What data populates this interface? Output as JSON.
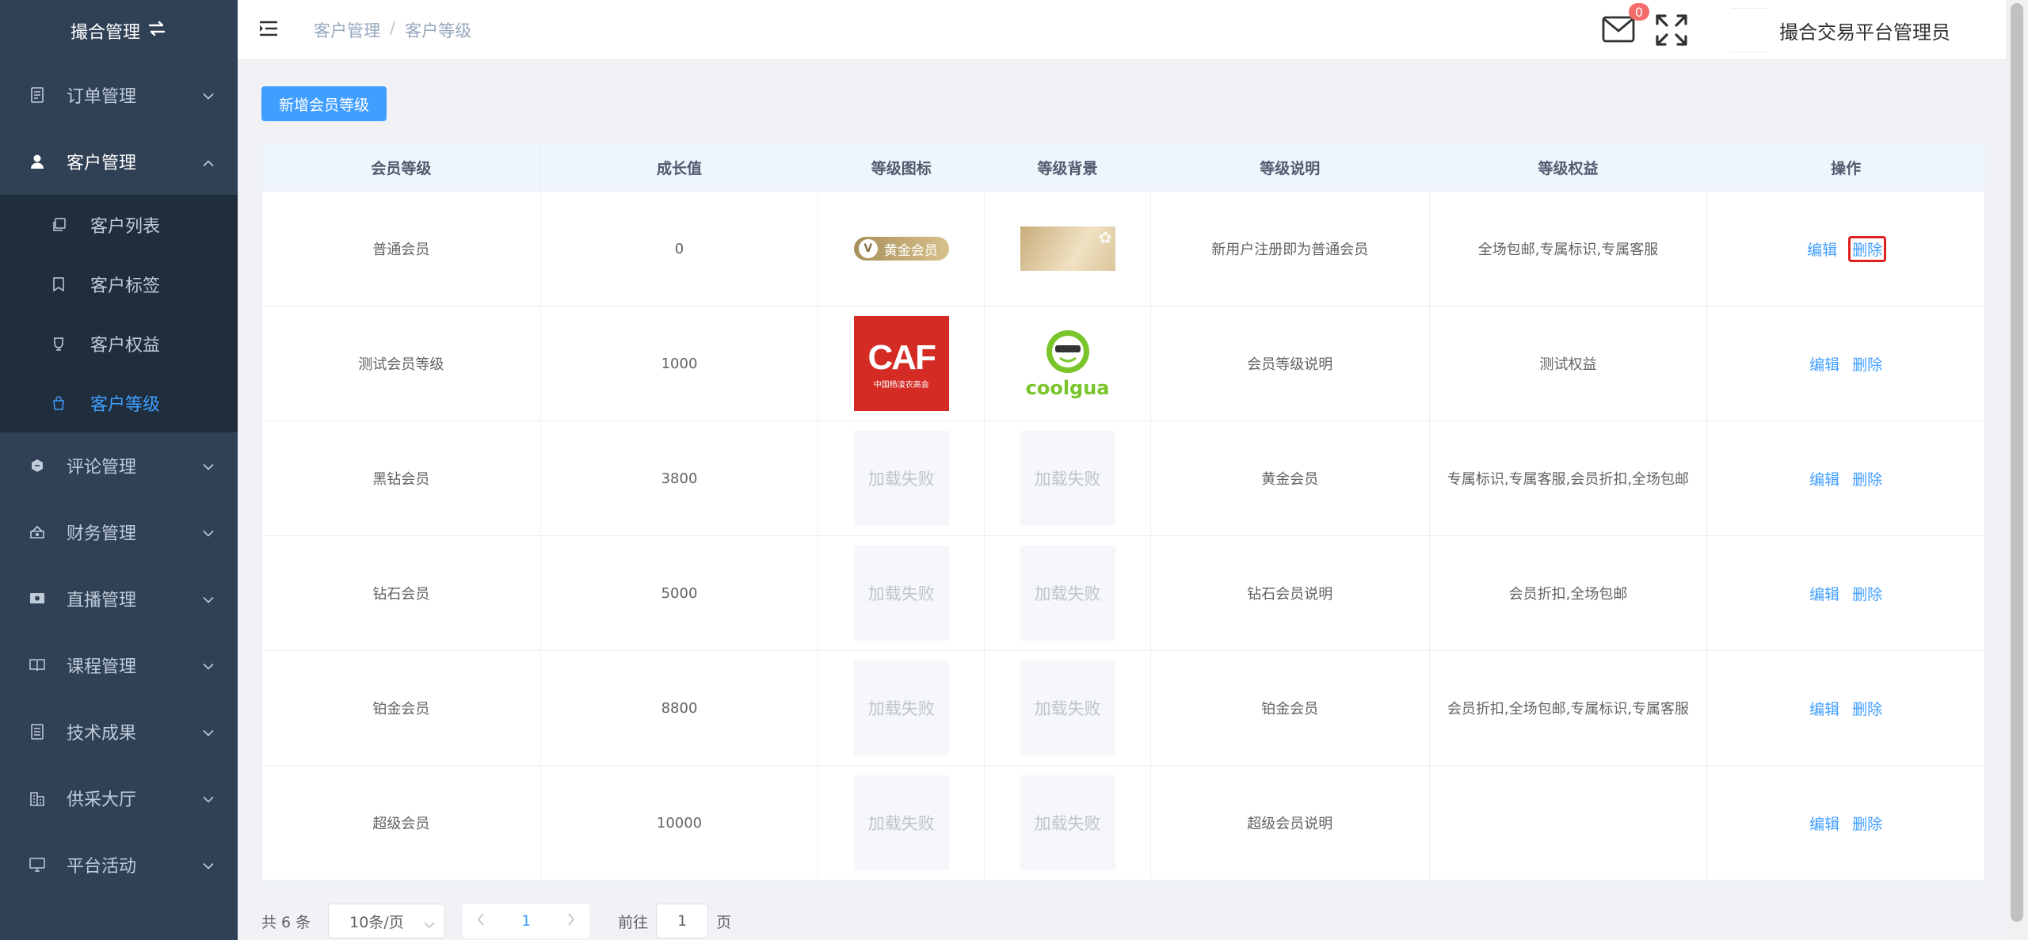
{
  "sidebar": {
    "title": "撮合管理",
    "menus": [
      {
        "label": "订单管理",
        "open": false
      },
      {
        "label": "客户管理",
        "open": true
      },
      {
        "label": "评论管理",
        "open": false
      },
      {
        "label": "财务管理",
        "open": false
      },
      {
        "label": "直播管理",
        "open": false
      },
      {
        "label": "课程管理",
        "open": false
      },
      {
        "label": "技术成果",
        "open": false
      },
      {
        "label": "供采大厅",
        "open": false
      },
      {
        "label": "平台活动",
        "open": false
      }
    ],
    "sub_items": [
      {
        "label": "客户列表"
      },
      {
        "label": "客户标签"
      },
      {
        "label": "客户权益"
      },
      {
        "label": "客户等级",
        "active": true
      }
    ]
  },
  "header": {
    "breadcrumb": [
      "客户管理",
      "客户等级"
    ],
    "breadcrumb_sep": "/",
    "mail_badge": "0",
    "admin_name": "撮合交易平台管理员"
  },
  "toolbar": {
    "add_label": "新增会员等级"
  },
  "table": {
    "headers": [
      "会员等级",
      "成长值",
      "等级图标",
      "等级背景",
      "等级说明",
      "等级权益",
      "操作"
    ],
    "edit_label": "编辑",
    "delete_label": "删除",
    "fail_label": "加载失败",
    "rows": [
      {
        "level": "普通会员",
        "growth": "0",
        "icon": "vip-gold-badge",
        "bg": "gold-card",
        "desc": "新用户注册即为普通会员",
        "rights": "全场包邮,专属标识,专属客服"
      },
      {
        "level": "测试会员等级",
        "growth": "1000",
        "icon": "caf-logo",
        "bg": "coolgua-logo",
        "desc": "会员等级说明",
        "rights": "测试权益"
      },
      {
        "level": "黑钻会员",
        "growth": "3800",
        "icon": "failed",
        "bg": "failed",
        "desc": "黄金会员",
        "rights": "专属标识,专属客服,会员折扣,全场包邮"
      },
      {
        "level": "钻石会员",
        "growth": "5000",
        "icon": "failed",
        "bg": "failed",
        "desc": "钻石会员说明",
        "rights": "会员折扣,全场包邮"
      },
      {
        "level": "铂金会员",
        "growth": "8800",
        "icon": "failed",
        "bg": "failed",
        "desc": "铂金会员",
        "rights": "会员折扣,全场包邮,专属标识,专属客服"
      },
      {
        "level": "超级会员",
        "growth": "10000",
        "icon": "failed",
        "bg": "failed",
        "desc": "超级会员说明",
        "rights": ""
      }
    ],
    "badge_text": "黄金会员",
    "caf_text": "CAF",
    "caf_sub": "中国杨凌农高会",
    "coolgua_text": "coolgua"
  },
  "pagination": {
    "total": "共 6 条",
    "page_size": "10条/页",
    "current": "1",
    "goto_prefix": "前往",
    "goto_value": "1",
    "goto_suffix": "页"
  },
  "colors": {
    "sidebar": "#304156",
    "primary": "#409eff",
    "danger": "#e02020"
  }
}
